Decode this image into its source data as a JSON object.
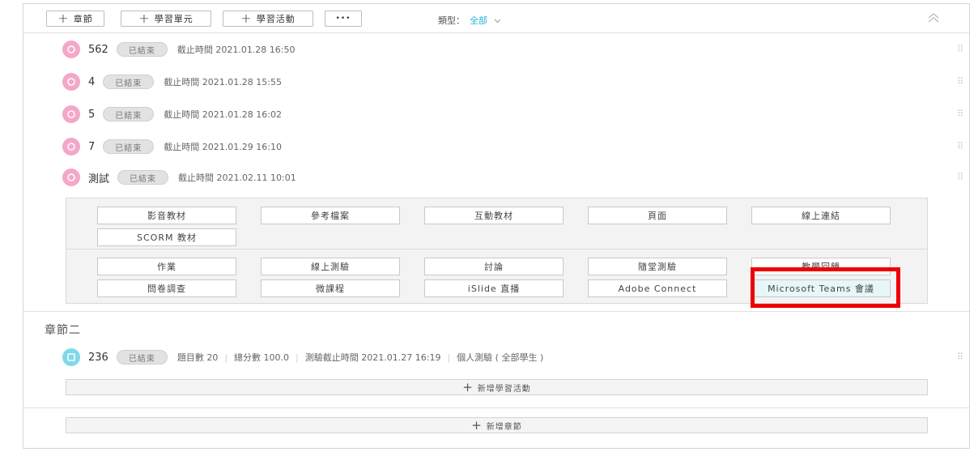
{
  "toolbar": {
    "add_chapter": "章節",
    "add_unit": "學習單元",
    "add_activity": "學習活動",
    "more": "•••",
    "type_label": "類型：",
    "type_value": "全部"
  },
  "chapter1": {
    "activities": [
      {
        "name": "562",
        "status": "已結束",
        "deadline": "截止時間 2021.01.28 16:50"
      },
      {
        "name": "4",
        "status": "已結束",
        "deadline": "截止時間 2021.01.28 15:55"
      },
      {
        "name": "5",
        "status": "已結束",
        "deadline": "截止時間 2021.01.28 16:02"
      },
      {
        "name": "7",
        "status": "已結束",
        "deadline": "截止時間 2021.01.29 16:10"
      },
      {
        "name": "測試",
        "status": "已結束",
        "deadline": "截止時間 2021.02.11 10:01"
      }
    ]
  },
  "panel": {
    "materials": [
      "影音教材",
      "參考檔案",
      "互動教材",
      "頁面",
      "線上連結",
      "SCORM 教材"
    ],
    "activities": [
      "作業",
      "線上測驗",
      "討論",
      "隨堂測驗",
      "教學回饋",
      "問卷調查",
      "微課程",
      "iSlide 直播",
      "Adobe Connect",
      "Microsoft Teams 會議"
    ]
  },
  "chapter2": {
    "title": "章節二",
    "activity": {
      "name": "236",
      "status": "已結束",
      "questions": "題目數 20",
      "score": "總分數 100.0",
      "deadline": "測驗截止時間 2021.01.27 16:19",
      "scope": "個人測驗 ( 全部學生 )"
    },
    "add_activity": "新增學習活動"
  },
  "add_chapter": "新增章節"
}
